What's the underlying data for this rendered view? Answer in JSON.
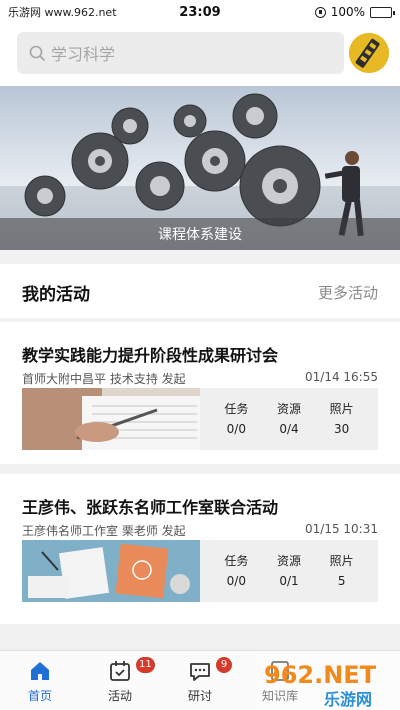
{
  "status_bar": {
    "carrier": "乐游网 www.962.net",
    "time": "23:09",
    "battery": "100%",
    "battery_level": 1.0
  },
  "search": {
    "placeholder": "学习科学"
  },
  "banner": {
    "caption": "课程体系建设"
  },
  "section": {
    "title": "我的活动",
    "more": "更多活动"
  },
  "activities": [
    {
      "title": "教学实践能力提升阶段性成果研讨会",
      "organizer": "首师大附中昌平 技术支持 发起",
      "date": "01/14 16:55",
      "stats": [
        {
          "label": "任务",
          "value": "0/0"
        },
        {
          "label": "资源",
          "value": "0/4"
        },
        {
          "label": "照片",
          "value": "30"
        }
      ]
    },
    {
      "title": "王彦伟、张跃东名师工作室联合活动",
      "organizer": "王彦伟名师工作室 栗老师 发起",
      "date": "01/15 10:31",
      "stats": [
        {
          "label": "任务",
          "value": "0/0"
        },
        {
          "label": "资源",
          "value": "0/1"
        },
        {
          "label": "照片",
          "value": "5"
        }
      ]
    }
  ],
  "tabs": [
    {
      "label": "首页",
      "active": true
    },
    {
      "label": "活动",
      "badge": "11"
    },
    {
      "label": "研讨",
      "badge": "9"
    },
    {
      "label": "知识库"
    }
  ],
  "watermark": {
    "line1": "962.NET",
    "line2": "乐游网"
  },
  "colors": {
    "accent": "#1f6fd6",
    "badge": "#d43b2a",
    "avatar": "#e7b925"
  }
}
